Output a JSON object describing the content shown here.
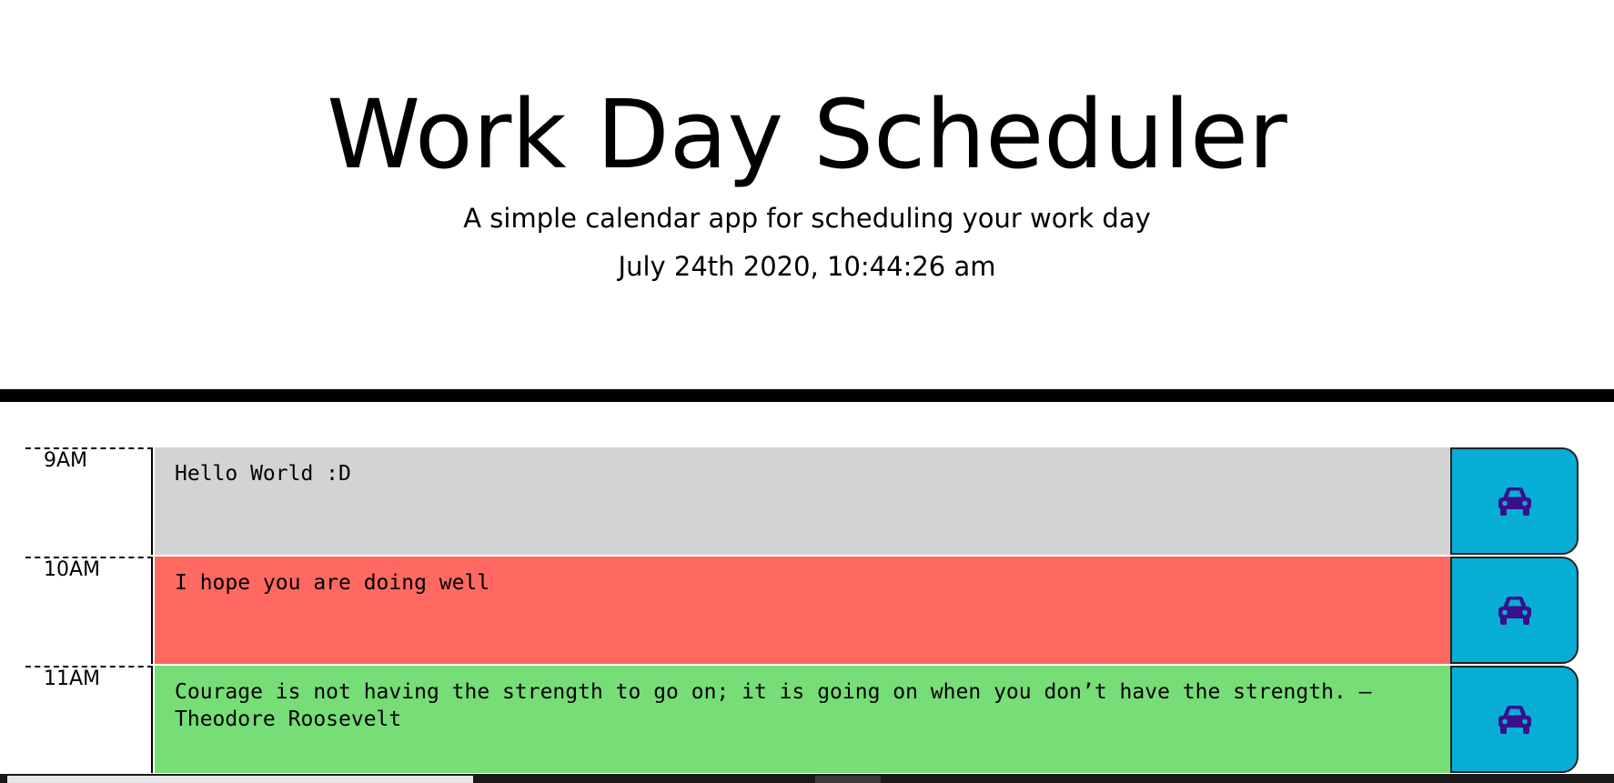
{
  "header": {
    "title": "Work Day Scheduler",
    "subtitle": "A simple calendar app for scheduling your work day",
    "current_day": "July 24th 2020, 10:44:26 am"
  },
  "time_blocks": [
    {
      "hour": "9AM",
      "text": "Hello World :D",
      "state": "past",
      "color": "#d3d3d3",
      "save_icon": "car-icon"
    },
    {
      "hour": "10AM",
      "text": "I hope you are doing well",
      "state": "present",
      "color": "#ff6961",
      "save_icon": "car-icon"
    },
    {
      "hour": "11AM",
      "text": "Courage is not having the strength to go on; it is going on when you don’t have the strength. – Theodore Roosevelt",
      "state": "future",
      "color": "#77dd77",
      "save_icon": "car-icon"
    }
  ],
  "colors": {
    "save_button": "#06aed5",
    "icon": "#3a0f8c",
    "divider": "#000000"
  }
}
